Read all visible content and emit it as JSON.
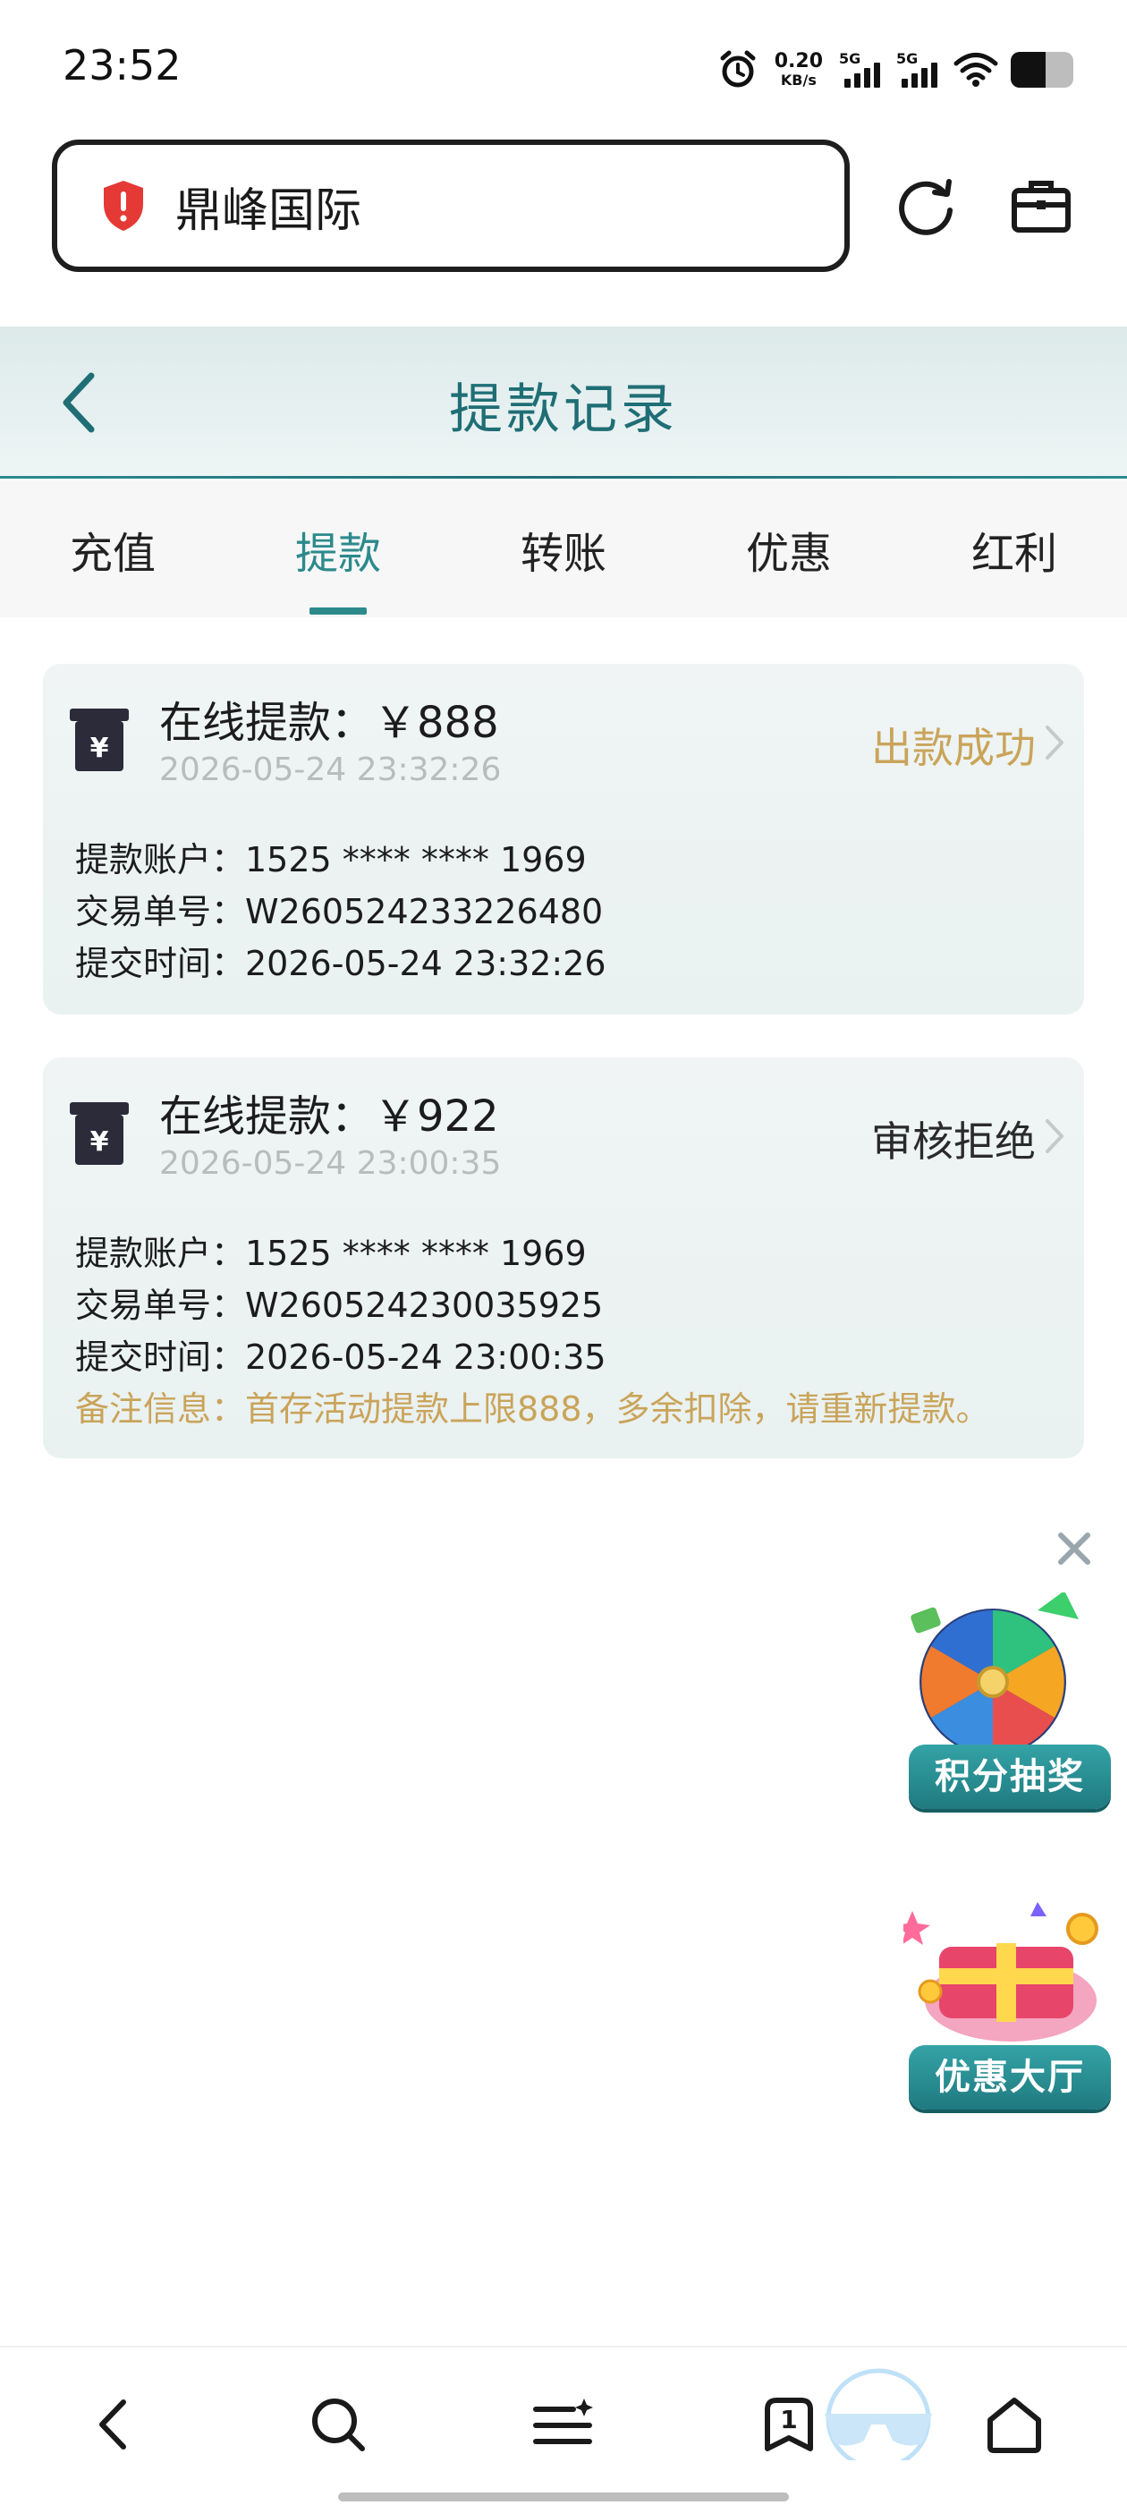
{
  "status_bar": {
    "time": "23:52",
    "net_speed_value": "0.20",
    "net_speed_unit": "KB/s",
    "sim1_label": "5G",
    "sim2_label": "5G",
    "battery_percent": 55
  },
  "browser": {
    "url_title": "鼎峰国际",
    "security_icon": "alert-shield-icon",
    "reload_icon": "reload-icon",
    "toolbox_icon": "briefcase-icon"
  },
  "header": {
    "title": "提款记录",
    "back_icon": "chevron-left-icon"
  },
  "tabs": [
    {
      "label": "充值",
      "active": false
    },
    {
      "label": "提款",
      "active": true
    },
    {
      "label": "转账",
      "active": false
    },
    {
      "label": "优惠",
      "active": false
    },
    {
      "label": "红利",
      "active": false
    }
  ],
  "records": [
    {
      "title": "在线提款：￥888",
      "date": "2026-05-24 23:32:26",
      "status": "出款成功",
      "status_color": "#c9a45a",
      "account": "提款账户：1525 **** **** 1969",
      "order_no": "交易单号：W260524233226480",
      "submit_time": "提交时间：2026-05-24 23:32:26"
    },
    {
      "title": "在线提款：￥922",
      "date": "2026-05-24 23:00:35",
      "status": "审核拒绝",
      "status_color": "#2a2a2a",
      "account": "提款账户：1525 **** **** 1969",
      "order_no": "交易单号：W260524230035925",
      "submit_time": "提交时间：2026-05-24 23:00:35",
      "note": "备注信息：首存活动提款上限888，多余扣除，请重新提款。"
    }
  ],
  "promos": {
    "close_icon": "close-icon",
    "lottery_label": "积分抽奖",
    "lottery_icon": "prize-wheel-icon",
    "offers_label": "优惠大厅",
    "offers_icon": "gift-box-icon"
  },
  "bottom_nav": {
    "back_icon": "back-arrow-icon",
    "search_icon": "search-icon",
    "menu_icon": "menu-sparkle-icon",
    "tabs_icon": "tabs-icon",
    "tabs_count": "1",
    "home_icon": "home-icon"
  },
  "colors": {
    "accent": "#2c8a8c",
    "title": "#1f6e75",
    "success_gold": "#c9a45a",
    "alert_red": "#e53935"
  }
}
